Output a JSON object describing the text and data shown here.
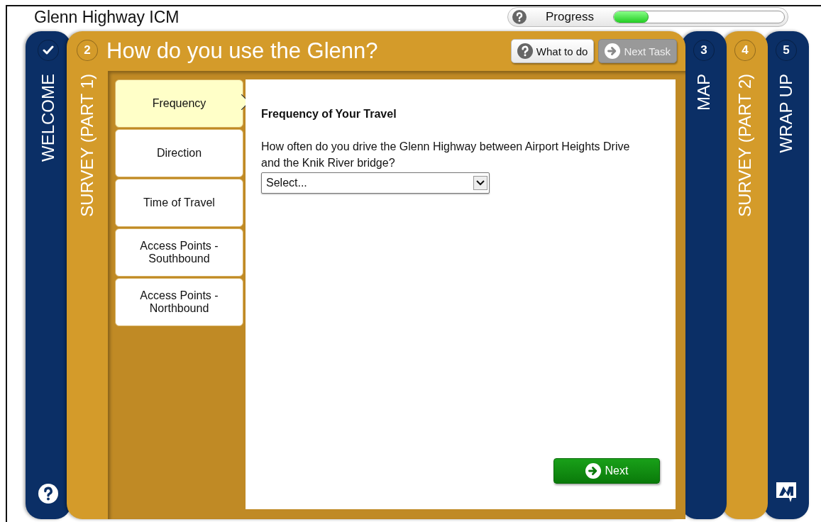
{
  "app_title": "Glenn Highway ICM",
  "progress": {
    "label": "Progress",
    "level": 0.2
  },
  "steps": [
    {
      "kind": "done",
      "label": "WELCOME",
      "color": "#0b2f66",
      "selected": false,
      "help_icon": true
    },
    {
      "kind": "number",
      "number": "2",
      "label": "SURVEY (PART 1)",
      "color": "#d49b2a",
      "selected": true
    },
    {
      "kind": "number",
      "number": "3",
      "label": "MAP",
      "color": "#0b2f66",
      "selected": false
    },
    {
      "kind": "number",
      "number": "4",
      "label": "SURVEY (PART 2)",
      "color": "#d49b2a",
      "selected": false
    },
    {
      "kind": "number",
      "number": "5",
      "label": "WRAP UP",
      "color": "#0b2f66",
      "selected": false,
      "logo_icon": true
    }
  ],
  "page_title": "How do you use the Glenn?",
  "header_buttons": [
    {
      "kind": "help",
      "label": "What to do",
      "disabled": false
    },
    {
      "kind": "next",
      "label": "Next Task",
      "disabled": true
    }
  ],
  "subtabs": [
    {
      "label": "Frequency",
      "selected": true
    },
    {
      "label": "Direction",
      "selected": false
    },
    {
      "label": "Time of Travel",
      "selected": false
    },
    {
      "label": "Access Points - Southbound",
      "selected": false
    },
    {
      "label": "Access Points - Northbound",
      "selected": false
    }
  ],
  "section_title": "Frequency of Your Travel",
  "question": "How often do you drive the Glenn Highway between Airport Heights Drive and the Knik River bridge?",
  "select": {
    "value": "Select..."
  },
  "next_button": "Next"
}
